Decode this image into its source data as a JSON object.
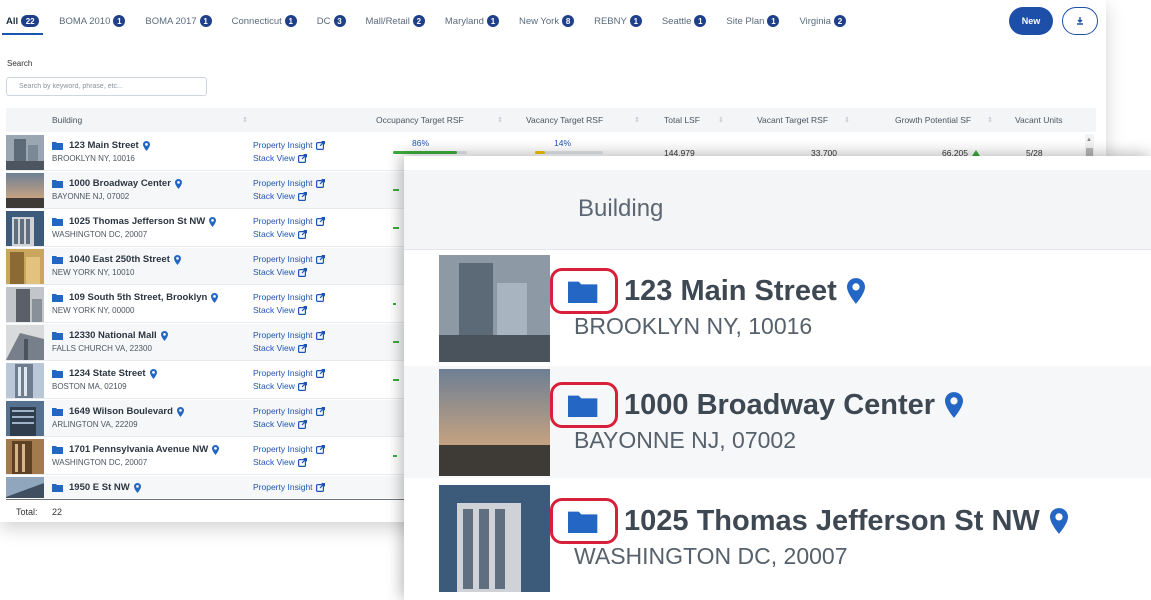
{
  "tabs": [
    {
      "label": "All",
      "count": "22",
      "active": true
    },
    {
      "label": "BOMA 2010",
      "count": "1"
    },
    {
      "label": "BOMA 2017",
      "count": "1"
    },
    {
      "label": "Connecticut",
      "count": "1"
    },
    {
      "label": "DC",
      "count": "3"
    },
    {
      "label": "Mall/Retail",
      "count": "2"
    },
    {
      "label": "Maryland",
      "count": "1"
    },
    {
      "label": "New York",
      "count": "8"
    },
    {
      "label": "REBNY",
      "count": "1"
    },
    {
      "label": "Seattle",
      "count": "1"
    },
    {
      "label": "Site Plan",
      "count": "1"
    },
    {
      "label": "Virginia",
      "count": "2"
    }
  ],
  "toolbar": {
    "new_label": "New",
    "download_icon": "download-icon"
  },
  "search": {
    "label": "Search",
    "placeholder": "Search by keyword, phrase, etc..."
  },
  "columns": {
    "building": "Building",
    "occupancy": "Occupancy Target RSF",
    "vacancy": "Vacancy Target RSF",
    "total_lsf": "Total LSF",
    "vacant_target": "Vacant Target RSF",
    "growth": "Growth Potential SF",
    "vacant_units": "Vacant Units"
  },
  "links": {
    "insight": "Property Insight",
    "stack": "Stack View"
  },
  "rows": [
    {
      "name": "123 Main Street",
      "address": "BROOKLYN NY, 10016",
      "occupancy_pct": "86%",
      "vacancy_pct": "14%",
      "total_lsf": "144,979",
      "vacant_target": "33,700",
      "growth": "66,205",
      "vacant_units": "5/28"
    },
    {
      "name": "1000 Broadway Center",
      "address": "BAYONNE NJ, 07002"
    },
    {
      "name": "1025 Thomas Jefferson St NW",
      "address": "WASHINGTON DC, 20007"
    },
    {
      "name": "1040 East 250th Street",
      "address": "NEW YORK NY, 10010"
    },
    {
      "name": "109 South 5th Street, Brooklyn",
      "address": "NEW YORK NY, 00000"
    },
    {
      "name": "12330 National Mall",
      "address": "FALLS CHURCH VA, 22300"
    },
    {
      "name": "1234 State Street",
      "address": "BOSTON MA, 02109"
    },
    {
      "name": "1649 Wilson Boulevard",
      "address": "ARLINGTON VA, 22209"
    },
    {
      "name": "1701 Pennsylvania Avenue NW",
      "address": "WASHINGTON DC, 20007"
    },
    {
      "name": "1950 E St NW",
      "address": ""
    }
  ],
  "footer": {
    "total_label": "Total:",
    "total_value": "22"
  },
  "zoom": {
    "header": "Building",
    "rows": [
      {
        "name": "123 Main Street",
        "address": "BROOKLYN NY, 10016"
      },
      {
        "name": "1000 Broadway Center",
        "address": "BAYONNE NJ, 07002"
      },
      {
        "name": "1025 Thomas Jefferson St NW",
        "address": "WASHINGTON DC, 20007"
      }
    ]
  },
  "colors": {
    "accent": "#1e4fa8",
    "link": "#1e55b3",
    "highlight_ring": "#d8203a",
    "growth_up": "#3cae3c",
    "vacancy_bar": "#f2c200"
  }
}
